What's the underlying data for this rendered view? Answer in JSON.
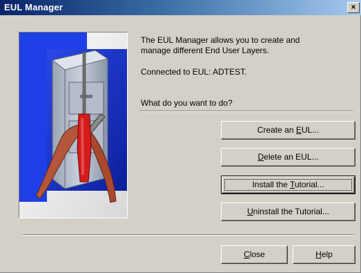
{
  "window": {
    "title": "EUL Manager",
    "close_glyph": "×"
  },
  "info": {
    "description_line1": "The EUL Manager allows you to create and",
    "description_line2": "manage different End User Layers.",
    "connected": "Connected to EUL: ADTEST.",
    "prompt": "What do you want to do?"
  },
  "actions": [
    {
      "pre": "Create an ",
      "key": "E",
      "post": "UL..."
    },
    {
      "pre": "",
      "key": "D",
      "post": "elete an EUL..."
    },
    {
      "pre": "Install the ",
      "key": "T",
      "post": "utorial..."
    },
    {
      "pre": "",
      "key": "U",
      "post": "ninstall the Tutorial..."
    }
  ],
  "footer": {
    "close": {
      "pre": "",
      "key": "C",
      "post": "lose"
    },
    "help": {
      "pre": "",
      "key": "H",
      "post": "elp"
    }
  },
  "image": {
    "icon": "filing-cabinet-tools-icon"
  },
  "colors": {
    "titlebar_start": "#0a246a",
    "titlebar_end": "#a6caf0",
    "dialog_bg": "#d4d0c8",
    "art_blue": "#1f3fdc"
  }
}
